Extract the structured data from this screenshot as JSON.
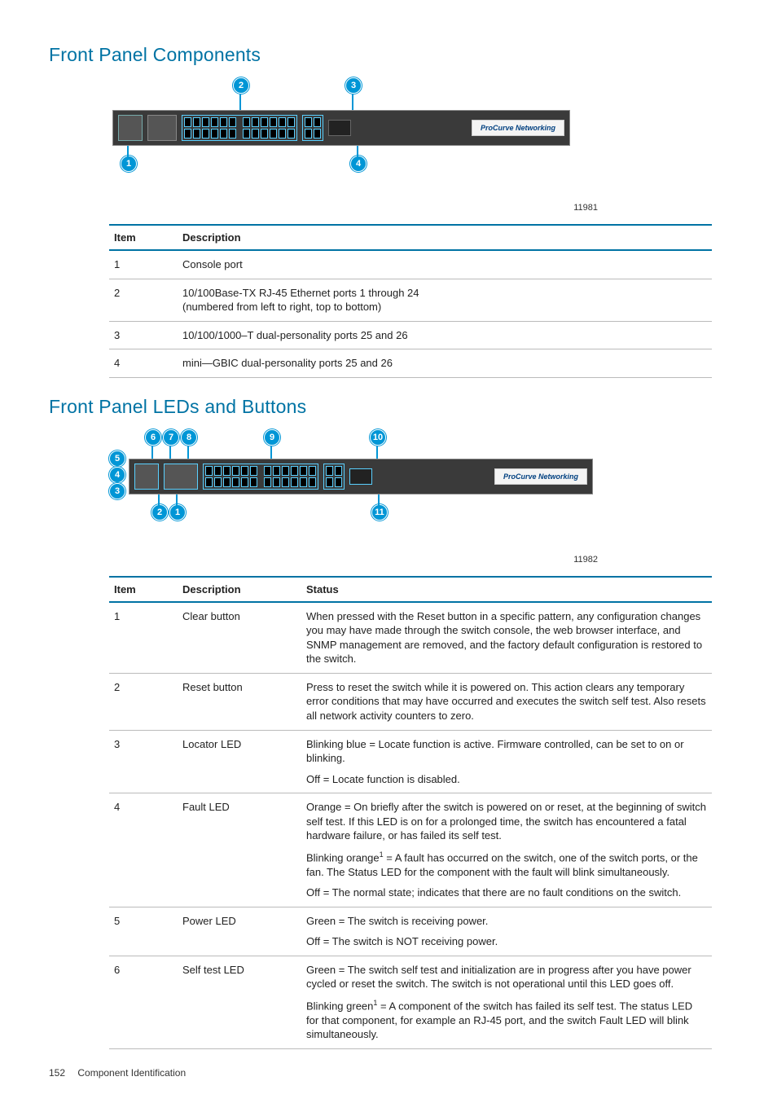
{
  "section1": {
    "title": "Front Panel Components",
    "brand": "ProCurve Networking",
    "caption": "11981",
    "callouts": [
      "1",
      "2",
      "3",
      "4"
    ],
    "table": {
      "headers": [
        "Item",
        "Description"
      ],
      "rows": [
        {
          "item": "1",
          "desc": "Console port"
        },
        {
          "item": "2",
          "desc": "10/100Base-TX RJ-45 Ethernet ports 1 through 24\n(numbered from left to right, top to bottom)"
        },
        {
          "item": "3",
          "desc": "10/100/1000–T dual-personality ports 25 and 26"
        },
        {
          "item": "4",
          "desc": "mini—GBIC dual-personality ports 25 and 26"
        }
      ]
    }
  },
  "section2": {
    "title": "Front Panel LEDs and Buttons",
    "brand": "ProCurve Networking",
    "caption": "11982",
    "callouts": [
      "1",
      "2",
      "3",
      "4",
      "5",
      "6",
      "7",
      "8",
      "9",
      "10",
      "11"
    ],
    "table": {
      "headers": [
        "Item",
        "Description",
        "Status"
      ],
      "rows": [
        {
          "item": "1",
          "desc": "Clear button",
          "status": [
            "When pressed with the Reset button in a specific pattern, any configuration changes you may have made through the switch console, the web browser interface, and SNMP management are removed, and the factory default configuration is restored to the switch."
          ]
        },
        {
          "item": "2",
          "desc": "Reset button",
          "status": [
            "Press to reset the switch while it is powered on. This action clears any temporary error conditions that may have occurred and executes the switch self test. Also resets all network activity counters to zero."
          ]
        },
        {
          "item": "3",
          "desc": "Locator LED",
          "status": [
            "Blinking blue = Locate function is active. Firmware controlled, can be set to on or blinking.",
            "Off = Locate function is disabled."
          ]
        },
        {
          "item": "4",
          "desc": "Fault LED",
          "status": [
            "Orange = On briefly after the switch is powered on or reset, at the beginning of switch self test. If this LED is on for a prolonged time, the switch has encountered a fatal hardware failure, or has failed its self test.",
            "Blinking orange<sup>1</sup> = A fault has occurred on the switch, one of the switch ports, or the fan. The Status LED for the component with the fault will blink simultaneously.",
            "Off = The normal state; indicates that there are no fault conditions on the switch."
          ]
        },
        {
          "item": "5",
          "desc": "Power LED",
          "status": [
            "Green = The switch is receiving power.",
            "Off = The switch is NOT receiving power."
          ]
        },
        {
          "item": "6",
          "desc": "Self test LED",
          "status": [
            "Green = The switch self test and initialization are in progress after you have power cycled or reset the switch. The switch is not operational until this LED goes off.",
            "Blinking green<sup>1</sup> = A component of the switch has failed its self test. The status LED for that component, for example an RJ-45 port, and the switch Fault LED will blink simultaneously."
          ]
        }
      ]
    }
  },
  "footer": {
    "page": "152",
    "section": "Component Identification"
  }
}
